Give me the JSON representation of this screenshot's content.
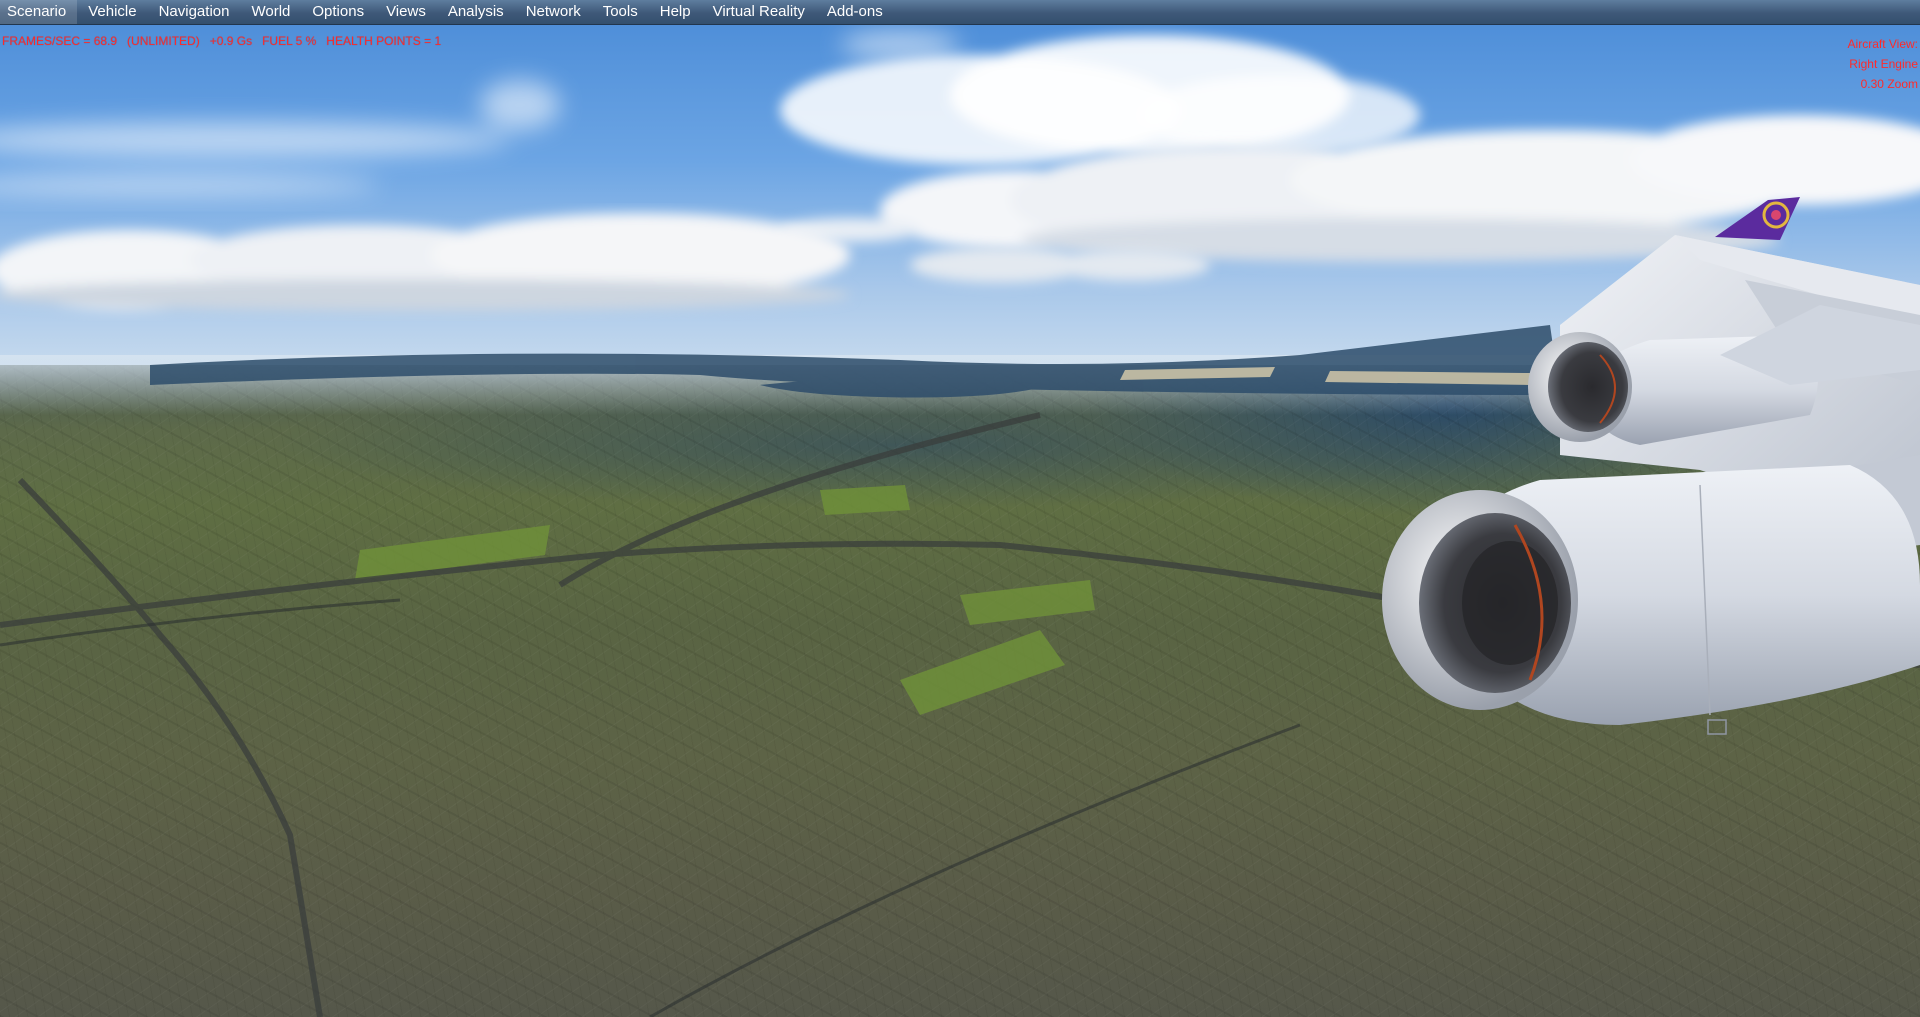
{
  "menu": {
    "items": [
      "Scenario",
      "Vehicle",
      "Navigation",
      "World",
      "Options",
      "Views",
      "Analysis",
      "Network",
      "Tools",
      "Help",
      "Virtual Reality",
      "Add-ons"
    ]
  },
  "hud": {
    "status_line": "FRAMES/SEC = 68.9   (UNLIMITED)   +0.9 Gs   FUEL 5 %   HEALTH POINTS = 1",
    "view_title": "Aircraft View:",
    "view_name": "Right Engine",
    "zoom": "0.30 Zoom",
    "color": "#ff2a2a"
  },
  "colors": {
    "menubar": "#3e5878",
    "sky_top": "#4f8fd9",
    "engine_nacelle": "#dfe4ec",
    "winglet_tail": "#5b2b9e"
  }
}
